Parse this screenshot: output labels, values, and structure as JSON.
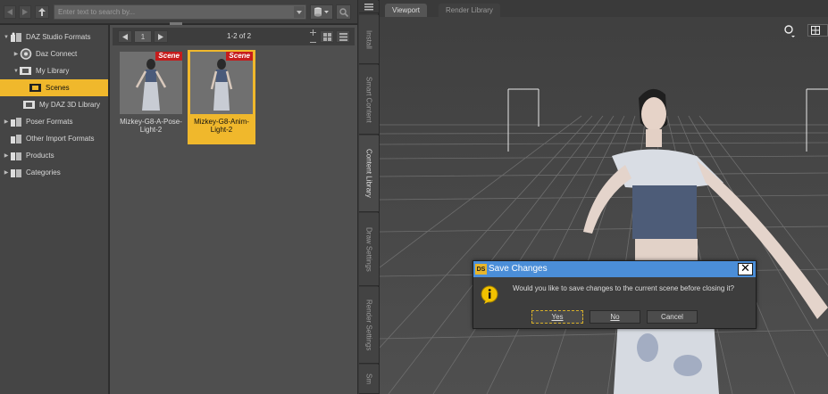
{
  "toolbar": {
    "search_placeholder": "Enter text to search by..."
  },
  "tree": {
    "items": [
      {
        "label": "DAZ Studio Formats",
        "icon": "daz-formats-icon"
      },
      {
        "label": "Daz Connect",
        "icon": "daz-connect-icon"
      },
      {
        "label": "My Library",
        "icon": "folder-icon"
      },
      {
        "label": "Scenes",
        "icon": "folder-icon"
      },
      {
        "label": "My DAZ 3D Library",
        "icon": "folder-icon"
      },
      {
        "label": "Poser Formats",
        "icon": "poser-icon"
      },
      {
        "label": "Other Import Formats",
        "icon": "import-icon"
      },
      {
        "label": "Products",
        "icon": "products-icon"
      },
      {
        "label": "Categories",
        "icon": "categories-icon"
      }
    ]
  },
  "pager": {
    "page": "1",
    "range": "1-2 of 2"
  },
  "assets": [
    {
      "label_line1": "Mizkey-G8-A-Pose-",
      "label_line2": "Light-2",
      "tag": "Scene"
    },
    {
      "label_line1": "Mizkey-G8-Anim-",
      "label_line2": "Light-2",
      "tag": "Scene"
    }
  ],
  "side_tabs": [
    "Install",
    "Smart Content",
    "Content Library",
    "Draw Settings",
    "Render Settings",
    "Sm"
  ],
  "viewport": {
    "tabs": [
      "Viewport",
      "Render Library"
    ]
  },
  "dialog": {
    "app_badge": "DS",
    "title": "Save Changes",
    "message": "Would you like to save changes to the current scene before closing it?",
    "yes": "Yes",
    "no": "No",
    "cancel": "Cancel"
  },
  "colors": {
    "selection": "#f0b82c",
    "scene_tag": "#c61c1c",
    "dialog_title": "#4b8ed8"
  }
}
